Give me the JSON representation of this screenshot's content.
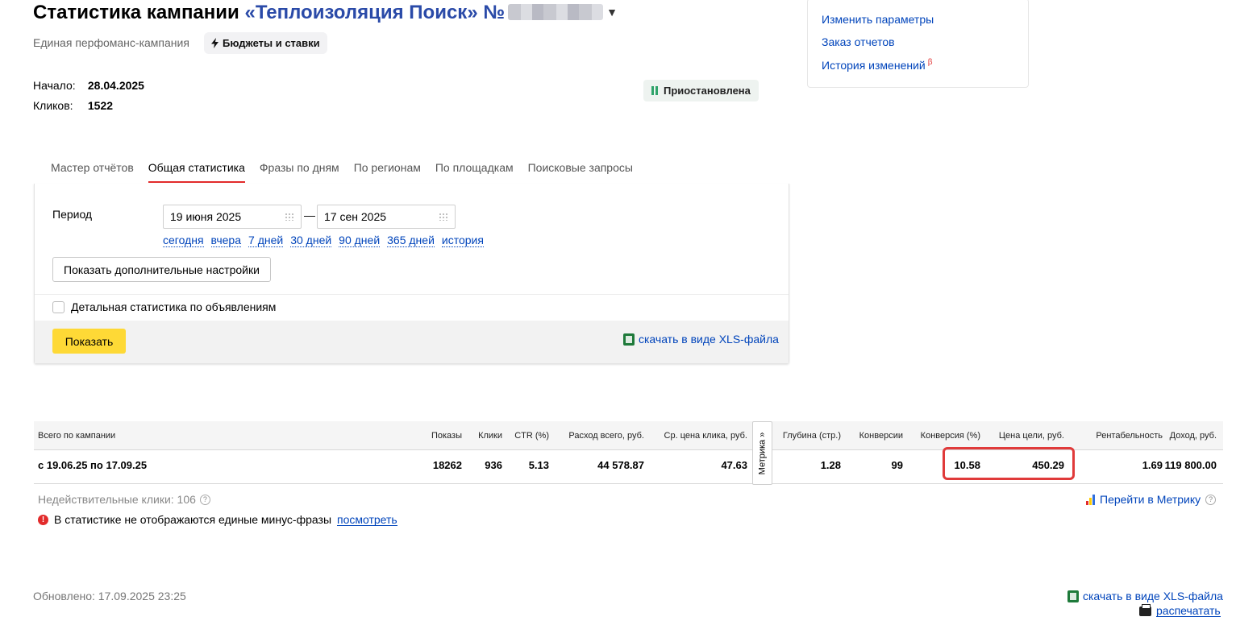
{
  "header": {
    "title_prefix": "Статистика кампании",
    "campaign_name": "«Теплоизоляция Поиск» №",
    "subtitle": "Единая перфоманс-кампания",
    "budget_chip": "Бюджеты и ставки"
  },
  "meta": {
    "start_label": "Начало:",
    "start_value": "28.04.2025",
    "clicks_label": "Кликов:",
    "clicks_value": "1522"
  },
  "status": "Приостановлена",
  "side_links": {
    "edit": "Изменить параметры",
    "reports": "Заказ отчетов",
    "history": "История изменений",
    "history_badge": "β"
  },
  "tabs": [
    "Мастер отчётов",
    "Общая статистика",
    "Фразы по дням",
    "По регионам",
    "По площадкам",
    "Поисковые запросы"
  ],
  "filters": {
    "period_label": "Период",
    "date_from": "19 июня 2025",
    "dash": "—",
    "date_to": "17 сен 2025",
    "quick": [
      "сегодня",
      "вчера",
      "7 дней",
      "30 дней",
      "90 дней",
      "365 дней",
      "история"
    ],
    "more_settings": "Показать дополнительные настройки",
    "detailed_checkbox": "Детальная статистика по объявлениям",
    "show_button": "Показать",
    "download_xls": "скачать в виде XLS-файла"
  },
  "table": {
    "headers": {
      "total": "Всего по кампании",
      "shows": "Показы",
      "clicks": "Клики",
      "ctr": "CTR (%)",
      "spend": "Расход всего, руб.",
      "cpc": "Ср. цена клика, руб.",
      "depth": "Глубина (стр.)",
      "conversions": "Конверсии",
      "conv_rate": "Конверсия (%)",
      "goal_cost": "Цена цели, руб.",
      "roi": "Рентабельность",
      "revenue": "Доход, руб."
    },
    "metrika_tab": "Метрика »",
    "row": {
      "period": "с 19.06.25 по 17.09.25",
      "shows": "18262",
      "clicks": "936",
      "ctr": "5.13",
      "spend": "44 578.87",
      "cpc": "47.63",
      "depth": "1.28",
      "conversions": "99",
      "conv_rate": "10.58",
      "goal_cost": "450.29",
      "roi": "1.69",
      "revenue": "119 800.00"
    }
  },
  "notes": {
    "invalid_clicks": "Недействительные клики: 106",
    "minus_phrases": "В статистике не отображаются единые минус-фразы",
    "minus_phrases_link": "посмотреть",
    "goto_metrika": "Перейти в Метрику"
  },
  "footer": {
    "updated": "Обновлено: 17.09.2025 23:25",
    "download_xls": "скачать в виде XLS-файла",
    "print": "распечатать"
  },
  "colors": {
    "link": "#0044bb",
    "accent_tab": "#e22b2b",
    "show_button": "#fed936",
    "status_pause": "#2fa36a",
    "highlight": "#e03a3a"
  }
}
